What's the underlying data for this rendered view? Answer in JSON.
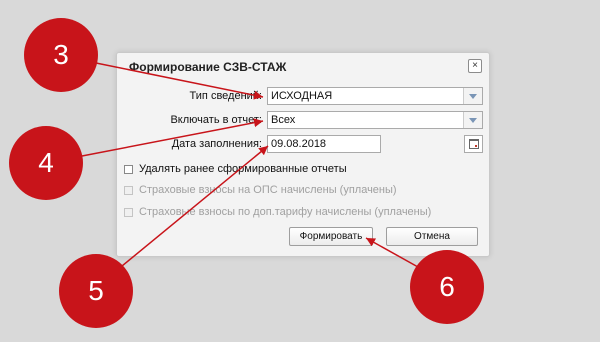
{
  "dialog": {
    "title": "Формирование СЗВ-СТАЖ",
    "close_label": "×",
    "fields": [
      {
        "label": "Тип сведений:",
        "value": "ИСХОДНАЯ"
      },
      {
        "label": "Включать в отчет:",
        "value": "Всех"
      },
      {
        "label": "Дата заполнения:",
        "value": "09.08.2018"
      }
    ],
    "checkboxes": [
      {
        "label": "Удалять ранее сформированные отчеты",
        "enabled": true
      },
      {
        "label": "Страховые взносы на ОПС начислены (уплачены)",
        "enabled": false
      },
      {
        "label": "Страховые взносы по доп.тарифу начислены (уплачены)",
        "enabled": false
      }
    ],
    "buttons": {
      "submit": "Формировать",
      "cancel": "Отмена"
    }
  },
  "callouts": [
    "3",
    "4",
    "5",
    "6"
  ],
  "colors": {
    "callout": "#c8141a",
    "background": "#d9d9d9",
    "dialog": "#f3f3f3"
  }
}
